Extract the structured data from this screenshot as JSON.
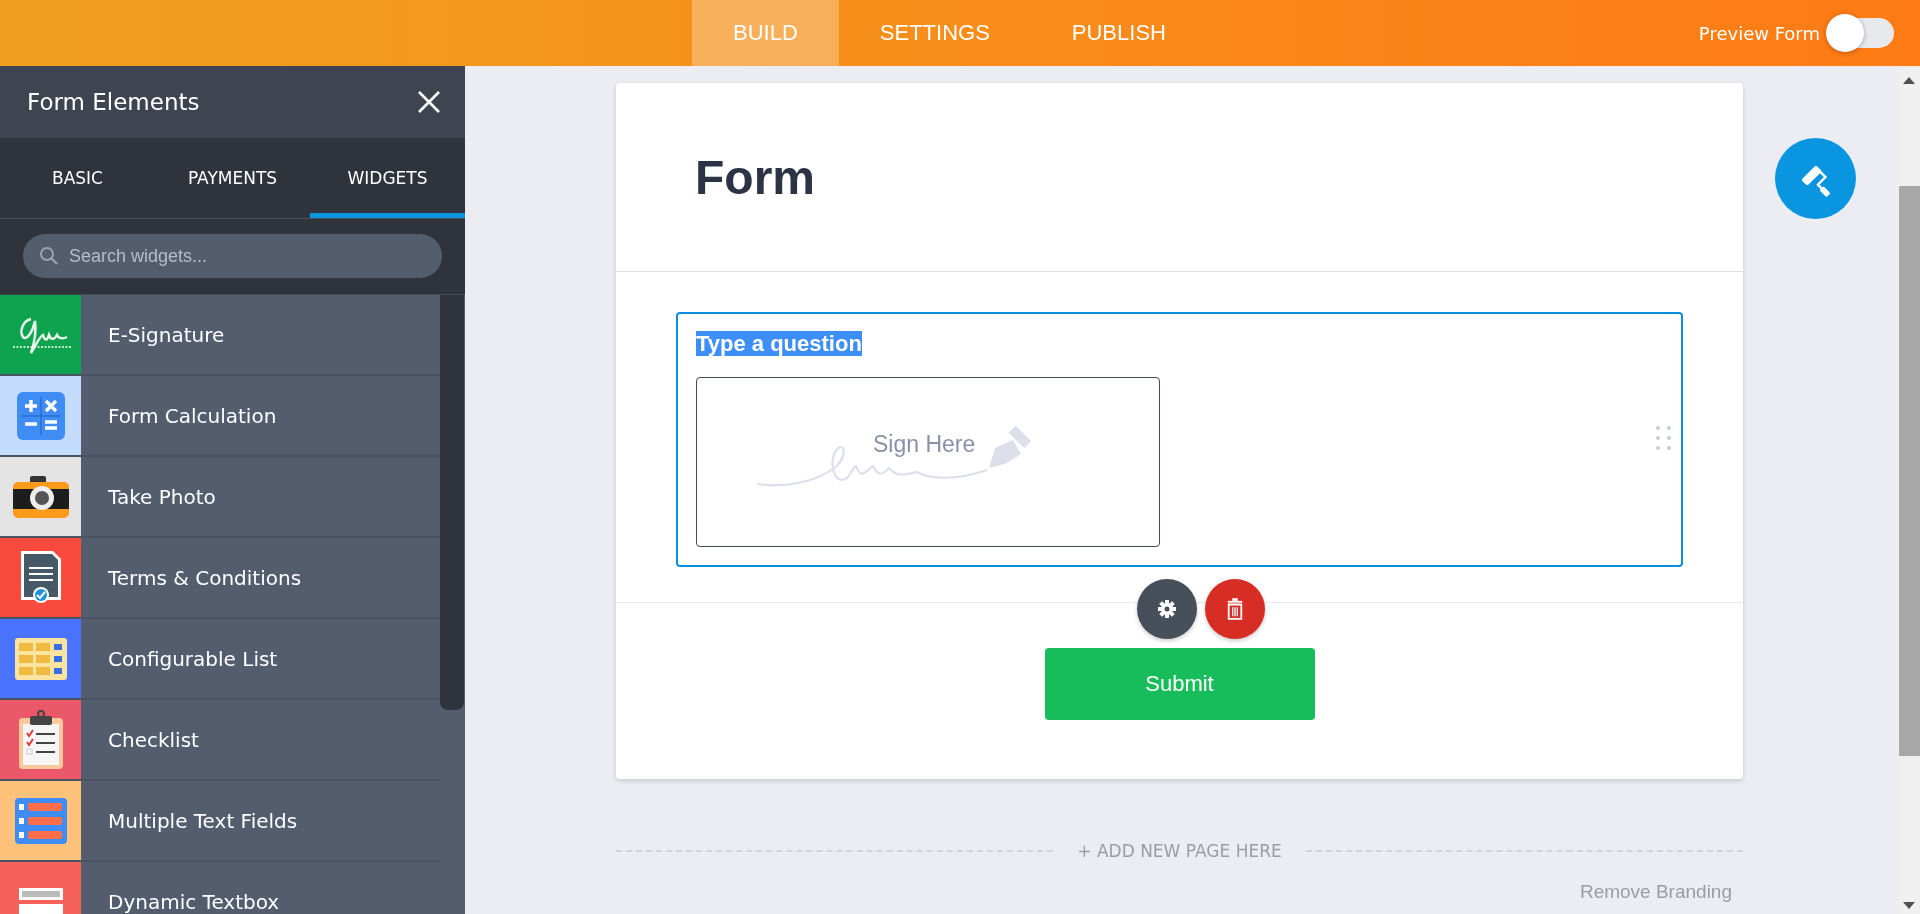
{
  "topbar": {
    "tabs": [
      {
        "label": "BUILD",
        "selected": true
      },
      {
        "label": "SETTINGS",
        "selected": false
      },
      {
        "label": "PUBLISH",
        "selected": false
      }
    ],
    "preview": {
      "label": "Preview Form",
      "on": false
    }
  },
  "sidebar": {
    "title": "Form Elements",
    "tabs": [
      {
        "label": "BASIC",
        "selected": false
      },
      {
        "label": "PAYMENTS",
        "selected": false
      },
      {
        "label": "WIDGETS",
        "selected": true
      }
    ],
    "search": {
      "placeholder": "Search widgets..."
    },
    "items": [
      {
        "name": "E-Signature",
        "kind": "signature",
        "color": "#0ea44f"
      },
      {
        "name": "Form Calculation",
        "kind": "calculator",
        "color": "#c4dcfc"
      },
      {
        "name": "Take Photo",
        "kind": "camera",
        "color": "#e4e4e4"
      },
      {
        "name": "Terms & Conditions",
        "kind": "document",
        "color": "#f94a3e"
      },
      {
        "name": "Configurable List",
        "kind": "grid",
        "color": "#4a73ff"
      },
      {
        "name": "Checklist",
        "kind": "clipboard",
        "color": "#eb5869"
      },
      {
        "name": "Multiple Text Fields",
        "kind": "fields",
        "color": "#ffc27a"
      },
      {
        "name": "Dynamic Textbox",
        "kind": "textbox",
        "color": "#f7615b"
      }
    ]
  },
  "form": {
    "title": "Form",
    "question": {
      "label": "Type a question",
      "highlighted": true,
      "selected": true,
      "placeholder": "Sign Here"
    },
    "submit": "Submit"
  },
  "add_page": "+ ADD NEW PAGE HERE",
  "footer_link": "Remove Branding"
}
